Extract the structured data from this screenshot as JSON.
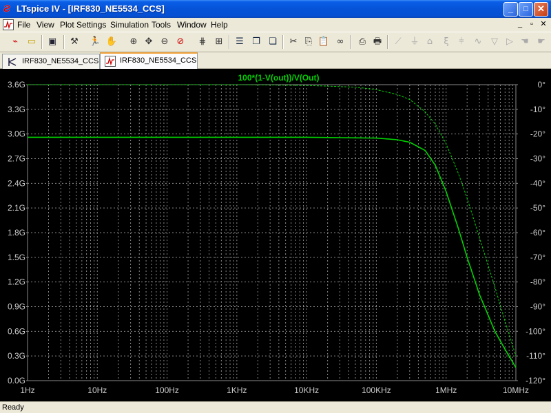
{
  "window": {
    "title": "LTspice IV - [IRF830_NE5534_CCS]",
    "minimize_label": "_",
    "maximize_label": "□",
    "close_label": "✕"
  },
  "menubar": {
    "items": [
      "File",
      "View",
      "Plot Settings",
      "Simulation",
      "Tools",
      "Window",
      "Help"
    ],
    "mdi_controls": [
      "_",
      "▫",
      "✕"
    ]
  },
  "tabs": [
    {
      "label": "IRF830_NE5534_CCS",
      "icon": "schematic-icon",
      "active": false
    },
    {
      "label": "IRF830_NE5534_CCS",
      "icon": "waveform-icon",
      "active": true
    }
  ],
  "plot": {
    "trace_label": "100*(1-V(out))/V(Out)",
    "trace_color": "#00d400",
    "background": "#000000",
    "grid_color": "#8a8a8a",
    "axis_text_color": "#cccccc"
  },
  "chart_data": {
    "type": "line",
    "title": "100*(1-V(out))/V(Out)",
    "xscale": "log",
    "x_ticks": [
      "1Hz",
      "10Hz",
      "100Hz",
      "1KHz",
      "10KHz",
      "100KHz",
      "1MHz",
      "10MHz"
    ],
    "xlim": [
      1,
      10000000
    ],
    "y_left_ticks": [
      "3.6G",
      "3.3G",
      "3.0G",
      "2.7G",
      "2.4G",
      "2.1G",
      "1.8G",
      "1.5G",
      "1.2G",
      "0.9G",
      "0.6G",
      "0.3G",
      "0.0G"
    ],
    "y_left_lim": [
      0,
      3.6
    ],
    "y_left_unit": "G",
    "y_right_ticks": [
      "0°",
      "-10°",
      "-20°",
      "-30°",
      "-40°",
      "-50°",
      "-60°",
      "-70°",
      "-80°",
      "-90°",
      "-100°",
      "-110°",
      "-120°"
    ],
    "y_right_lim": [
      -120,
      0
    ],
    "grid": true,
    "series": [
      {
        "name": "magnitude",
        "style": "solid",
        "axis": "left",
        "x": [
          1,
          10,
          100,
          1000,
          10000,
          100000,
          200000,
          300000,
          500000,
          700000,
          1000000,
          1500000,
          2000000,
          3000000,
          5000000,
          7000000,
          10000000
        ],
        "y": [
          2.96,
          2.96,
          2.96,
          2.96,
          2.96,
          2.95,
          2.93,
          2.9,
          2.8,
          2.62,
          2.3,
          1.85,
          1.5,
          1.05,
          0.6,
          0.38,
          0.16
        ]
      },
      {
        "name": "phase",
        "style": "dashed",
        "axis": "right",
        "x": [
          1,
          10,
          100,
          1000,
          10000,
          50000,
          100000,
          200000,
          300000,
          500000,
          700000,
          1000000,
          1500000,
          2000000,
          3000000,
          5000000,
          7000000,
          10000000
        ],
        "y": [
          0,
          0,
          0,
          0,
          -0.3,
          -1,
          -2,
          -4,
          -6,
          -11,
          -16,
          -24,
          -36,
          -46,
          -62,
          -82,
          -96,
          -110
        ]
      }
    ]
  },
  "status": {
    "text": "Ready"
  }
}
